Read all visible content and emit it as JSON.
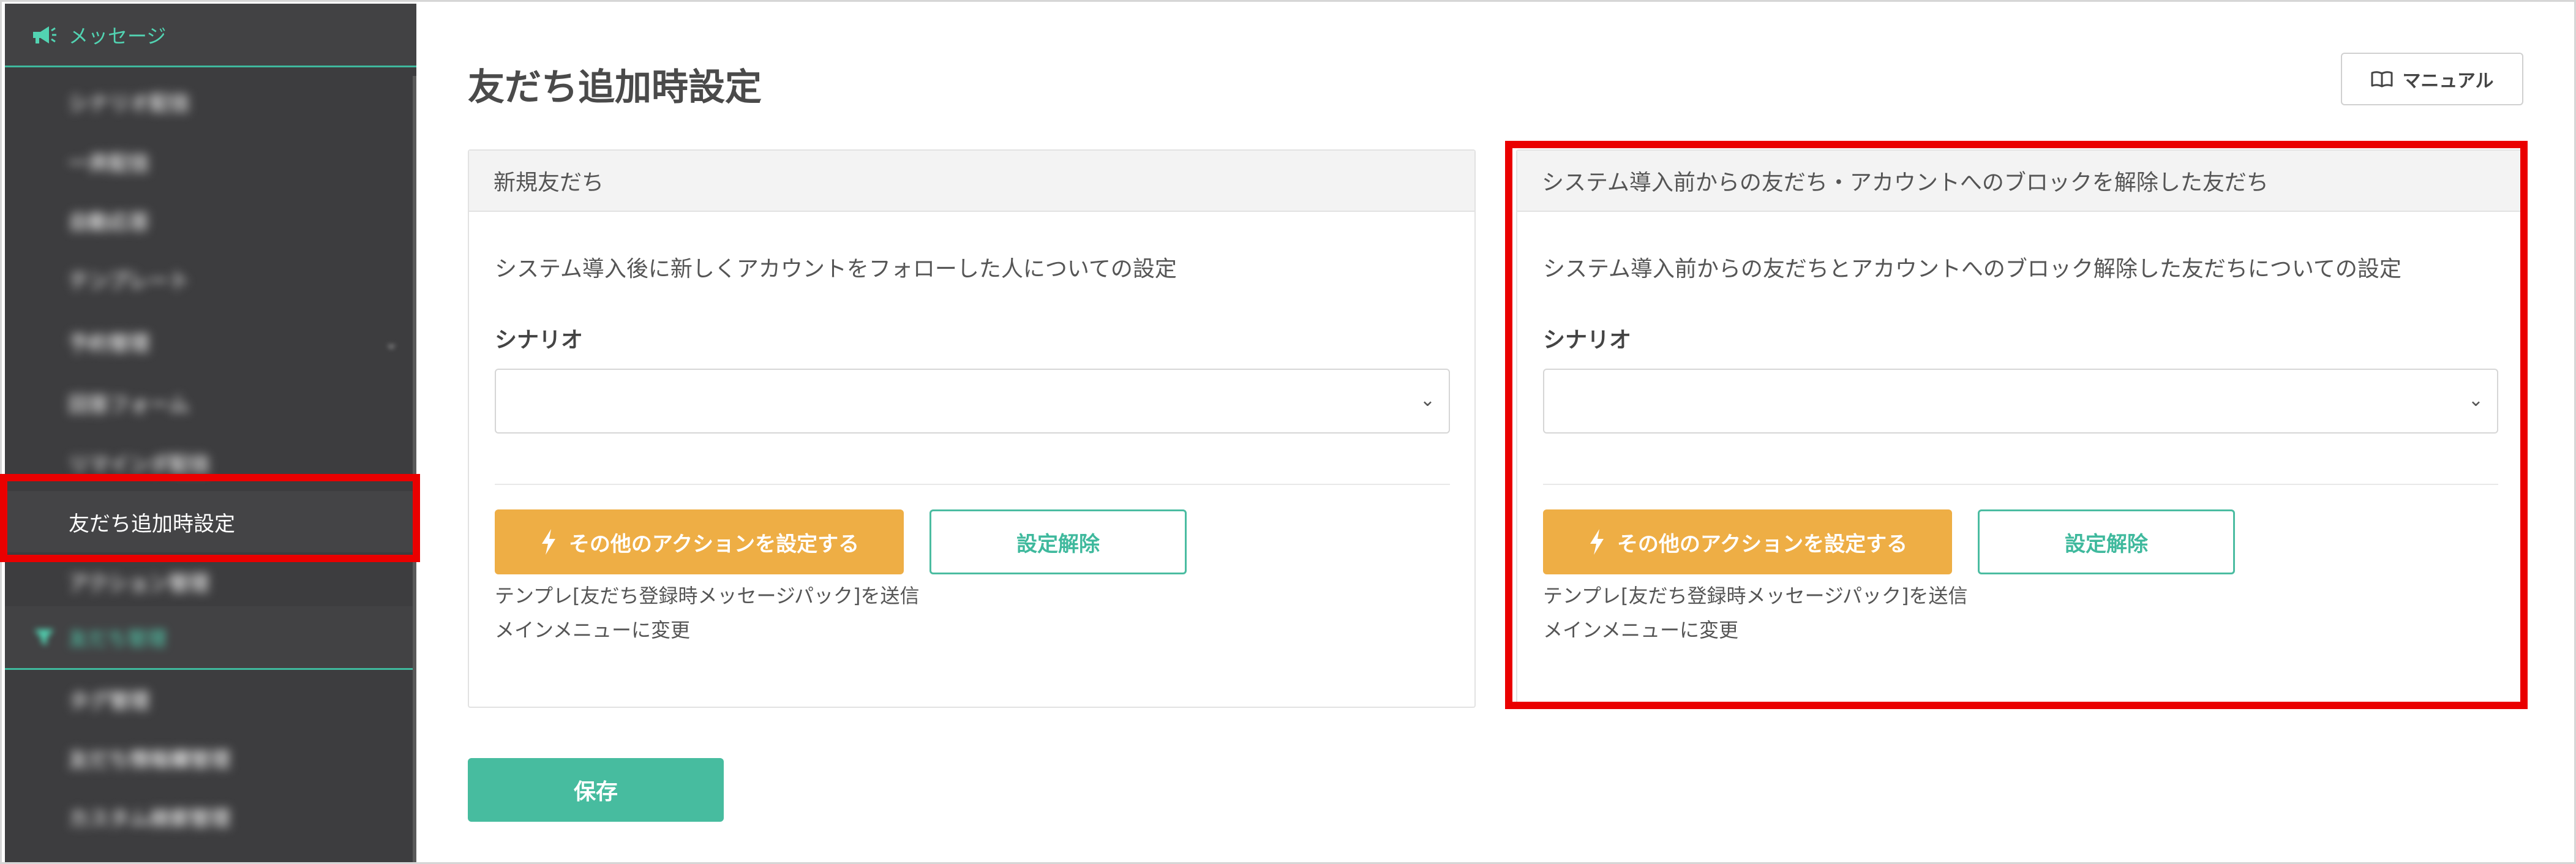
{
  "sidebar": {
    "section_messages": "メッセージ",
    "items": [
      {
        "label": "シナリオ配信"
      },
      {
        "label": "一斉配信"
      },
      {
        "label": "自動応答"
      },
      {
        "label": "テンプレート"
      },
      {
        "label": "予約管理"
      },
      {
        "label": "回答フォーム"
      },
      {
        "label": "リマインダ配信"
      },
      {
        "label": "友だち追加時設定"
      },
      {
        "label": "アクション管理"
      }
    ],
    "section_friends": "友だち管理",
    "items2": [
      {
        "label": "タグ管理"
      },
      {
        "label": "友だち情報欄管理"
      },
      {
        "label": "カスタム検索管理"
      }
    ],
    "accent_color": "#3fb99d",
    "bg_color": "#3d3d3f"
  },
  "page": {
    "title": "友だち追加時設定",
    "manual_label": "マニュアル"
  },
  "cards": {
    "left": {
      "header": "新規友だち",
      "description": "システム導入後に新しくアカウントをフォローした人についての設定",
      "scenario_label": "シナリオ",
      "scenario_value": "",
      "action_button": "その他のアクションを設定する",
      "unset_button": "設定解除",
      "note1": "テンプレ[友だち登録時メッセージパック]を送信",
      "note2": "メインメニューに変更"
    },
    "right": {
      "header": "システム導入前からの友だち・アカウントへのブロックを解除した友だち",
      "description": "システム導入前からの友だちとアカウントへのブロック解除した友だちについての設定",
      "scenario_label": "シナリオ",
      "scenario_value": "",
      "action_button": "その他のアクションを設定する",
      "unset_button": "設定解除",
      "note1": "テンプレ[友だち登録時メッセージパック]を送信",
      "note2": "メインメニューに変更"
    }
  },
  "footer": {
    "save_label": "保存"
  },
  "colors": {
    "action_orange": "#eeae45",
    "teal": "#47bc9f",
    "highlight_red": "#ea0000"
  },
  "icons": {
    "messages": "megaphone-icon",
    "friends": "funnel-icon",
    "manual": "book-icon",
    "action": "lightning-icon",
    "select": "chevron-down-icon"
  }
}
